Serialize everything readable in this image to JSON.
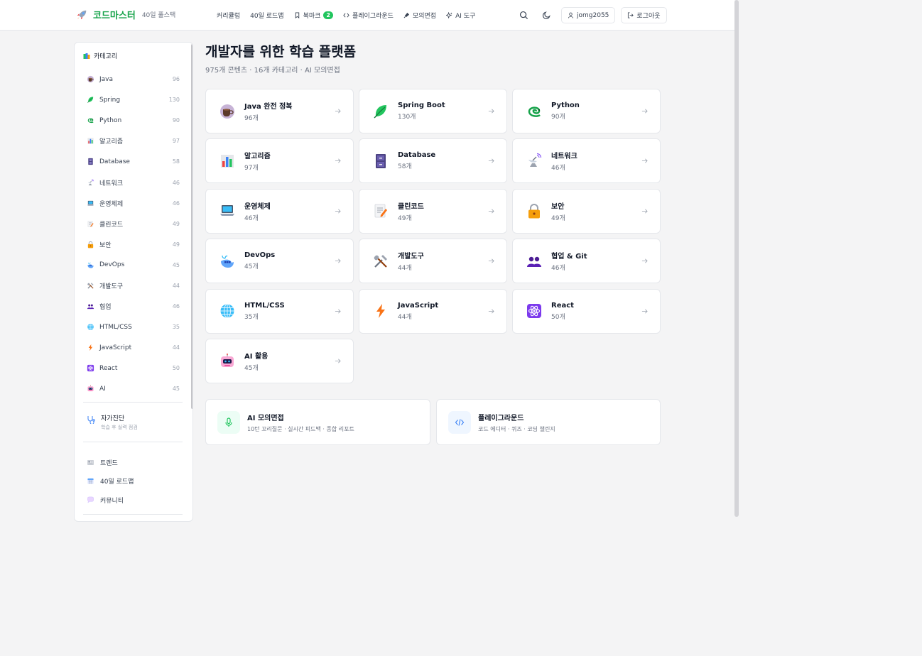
{
  "header": {
    "logo_text": "코드마스터",
    "logo_sub": "40일 풀스택",
    "nav": [
      {
        "label": "커리큘럼"
      },
      {
        "label": "40일 로드맵"
      },
      {
        "label": "북마크",
        "badge": "2",
        "icon": "bookmark-icon"
      },
      {
        "label": "플레이그라운드",
        "icon": "code-icon"
      },
      {
        "label": "모의면접",
        "icon": "mic-icon"
      },
      {
        "label": "AI 도구",
        "icon": "sparkles-icon"
      }
    ],
    "username": "jomg2055",
    "logout_label": "로그아웃"
  },
  "sidebar": {
    "title": "카테고리",
    "items": [
      {
        "label": "Java",
        "count": "96",
        "icon": "coffee-icon"
      },
      {
        "label": "Spring",
        "count": "130",
        "icon": "leaf-icon"
      },
      {
        "label": "Python",
        "count": "90",
        "icon": "snake-icon"
      },
      {
        "label": "알고리즘",
        "count": "97",
        "icon": "bar-chart-icon"
      },
      {
        "label": "Database",
        "count": "58",
        "icon": "file-cabinet-icon"
      },
      {
        "label": "네트워크",
        "count": "46",
        "icon": "satellite-icon"
      },
      {
        "label": "운영체제",
        "count": "46",
        "icon": "laptop-icon"
      },
      {
        "label": "클린코드",
        "count": "49",
        "icon": "memo-icon"
      },
      {
        "label": "보안",
        "count": "49",
        "icon": "lock-icon"
      },
      {
        "label": "DevOps",
        "count": "45",
        "icon": "whale-icon"
      },
      {
        "label": "개발도구",
        "count": "44",
        "icon": "tools-icon"
      },
      {
        "label": "협업",
        "count": "46",
        "icon": "people-icon"
      },
      {
        "label": "HTML/CSS",
        "count": "35",
        "icon": "globe-icon"
      },
      {
        "label": "JavaScript",
        "count": "44",
        "icon": "lightning-icon"
      },
      {
        "label": "React",
        "count": "50",
        "icon": "atom-icon"
      },
      {
        "label": "AI",
        "count": "45",
        "icon": "robot-icon"
      }
    ],
    "self_diag": {
      "title": "자가진단",
      "subtitle": "학습 후 실력 점검"
    },
    "links": [
      {
        "label": "트렌드",
        "icon": "newspaper-icon"
      },
      {
        "label": "40일 로드맵",
        "icon": "calendar-icon"
      },
      {
        "label": "커뮤니티",
        "icon": "speech-bubble-icon"
      }
    ]
  },
  "main": {
    "title": "개발자를 위한 학습 플랫폼",
    "subtitle": "975개 콘텐츠 · 16개 카테고리 · AI 모의면접",
    "cards": [
      {
        "name": "Java 완전 정복",
        "count": "96개",
        "icon": "coffee-icon"
      },
      {
        "name": "Spring Boot",
        "count": "130개",
        "icon": "leaf-icon"
      },
      {
        "name": "Python",
        "count": "90개",
        "icon": "snake-icon"
      },
      {
        "name": "알고리즘",
        "count": "97개",
        "icon": "bar-chart-icon"
      },
      {
        "name": "Database",
        "count": "58개",
        "icon": "file-cabinet-icon"
      },
      {
        "name": "네트워크",
        "count": "46개",
        "icon": "satellite-icon"
      },
      {
        "name": "운영체제",
        "count": "46개",
        "icon": "laptop-icon"
      },
      {
        "name": "클린코드",
        "count": "49개",
        "icon": "memo-icon"
      },
      {
        "name": "보안",
        "count": "49개",
        "icon": "lock-icon"
      },
      {
        "name": "DevOps",
        "count": "45개",
        "icon": "whale-icon"
      },
      {
        "name": "개발도구",
        "count": "44개",
        "icon": "tools-icon"
      },
      {
        "name": "협업 & Git",
        "count": "46개",
        "icon": "people-icon"
      },
      {
        "name": "HTML/CSS",
        "count": "35개",
        "icon": "globe-icon"
      },
      {
        "name": "JavaScript",
        "count": "44개",
        "icon": "lightning-icon"
      },
      {
        "name": "React",
        "count": "50개",
        "icon": "atom-icon"
      },
      {
        "name": "AI 활용",
        "count": "45개",
        "icon": "robot-icon"
      }
    ],
    "features": [
      {
        "title": "AI 모의면접",
        "desc": "10턴 꼬리질문 · 실시간 피드백 · 종합 리포트",
        "icon": "mic-icon",
        "bg": "#ecfdf5",
        "color": "#22c55e"
      },
      {
        "title": "플레이그라운드",
        "desc": "코드 에디터 · 퀴즈 · 코딩 챌린지",
        "icon": "code-icon",
        "bg": "#eff6ff",
        "color": "#3b82f6"
      }
    ]
  },
  "colors": {
    "brand": "#16a34a",
    "badge": "#22c55e"
  }
}
